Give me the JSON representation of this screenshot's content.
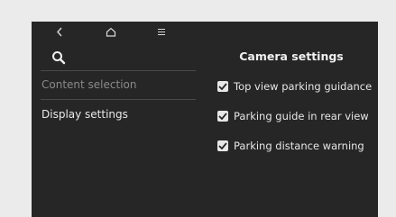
{
  "topbar": {
    "back_icon": "chevron-left-icon",
    "home_icon": "home-icon",
    "menu_icon": "hamburger-menu-icon"
  },
  "sidebar": {
    "search_icon": "search-icon",
    "items": [
      {
        "label": "Content selection",
        "state": "dimmed"
      },
      {
        "label": "Display settings",
        "state": "active"
      }
    ]
  },
  "camera_settings": {
    "title": "Camera settings",
    "options": [
      {
        "label": "Top view parking guidance",
        "checked": true
      },
      {
        "label": "Parking guide in rear view",
        "checked": true
      },
      {
        "label": "Parking distance warning",
        "checked": true
      }
    ]
  },
  "colors": {
    "screen_bg": "#262626",
    "page_bg": "#ebebeb",
    "text": "#e6e6e6",
    "dim_text": "#8a8a8a",
    "checkbox": "#e8e8e8"
  }
}
